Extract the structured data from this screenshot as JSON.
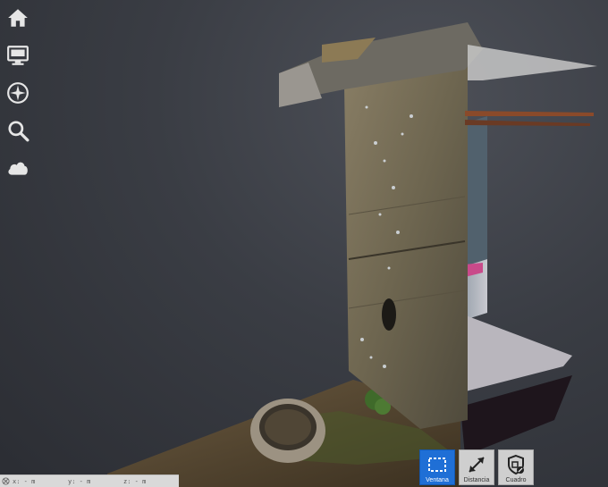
{
  "toolbar": {
    "items": [
      {
        "icon": "home-icon"
      },
      {
        "icon": "monitor-icon"
      },
      {
        "icon": "compass-icon"
      },
      {
        "icon": "search-icon"
      },
      {
        "icon": "cloud-icon"
      }
    ]
  },
  "coords": {
    "x": "x: - m",
    "y": "y: - m",
    "z": "z: - m"
  },
  "measure": {
    "window_label": "Ventana",
    "distance_label": "Distancia",
    "box_label": "Cuadro",
    "active": "Ventana"
  },
  "colors": {
    "accent": "#1f6fd6",
    "background": "#3a3d44"
  }
}
